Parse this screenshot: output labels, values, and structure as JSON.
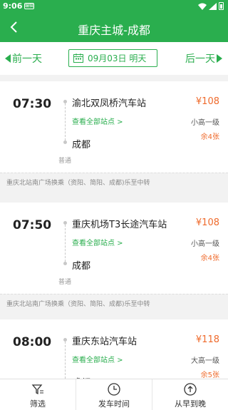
{
  "status_bar": {
    "time": "9:06",
    "badge": "编辑"
  },
  "header": {
    "title": "重庆主城-成都"
  },
  "date_bar": {
    "prev_label": "前一天",
    "date_text": "09月03日  明天",
    "next_label": "后一天"
  },
  "schedules": [
    {
      "time": "07:30",
      "from": "渝北双凤桥汽车站",
      "view_stops": "查看全部站点 >",
      "to": "成都",
      "class": "普通",
      "price": "¥108",
      "bus_type": "小高一级",
      "seats": "余4张",
      "notice": "重庆北站南广场换乘（资阳、简阳、成都)乐至中转"
    },
    {
      "time": "07:50",
      "from": "重庆机场T3长途汽车站",
      "view_stops": "查看全部站点 >",
      "to": "成都",
      "class": "普通",
      "price": "¥108",
      "bus_type": "小高一级",
      "seats": "余4张",
      "notice": "重庆北站南广场换乘（资阳、简阳、成都)乐至中转"
    },
    {
      "time": "08:00",
      "from": "重庆东站汽车站",
      "view_stops": "查看全部站点 >",
      "to": "成都",
      "class": "",
      "price": "¥118",
      "bus_type": "大高一级",
      "seats": "余5张",
      "notice": ""
    }
  ],
  "footer": {
    "tabs": [
      {
        "label": "筛选",
        "icon": "filter-icon"
      },
      {
        "label": "发车时间",
        "icon": "clock-icon"
      },
      {
        "label": "从早到晚",
        "icon": "sort-time-icon"
      }
    ]
  }
}
